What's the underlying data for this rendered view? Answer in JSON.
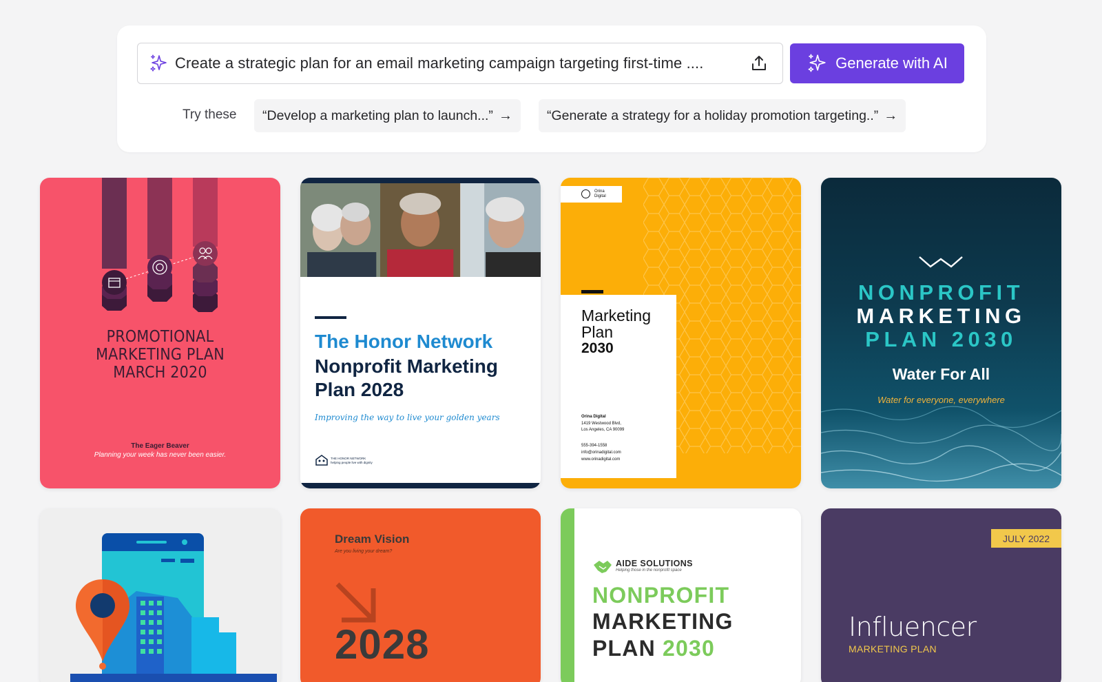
{
  "prompt": {
    "text": "Create a strategic plan for an email marketing campaign targeting first-time ....",
    "generate_label": "Generate with AI",
    "try_label": "Try these",
    "suggestions": [
      "“Develop a marketing plan to launch...”",
      "“Generate a strategy for a holiday promotion targeting..”"
    ],
    "arrow": "→"
  },
  "templates": {
    "promo": {
      "title_line1": "PROMOTIONAL",
      "title_line2": "MARKETING PLAN",
      "title_line3": "MARCH 2020",
      "brand": "The Eager Beaver",
      "tagline": "Planning your week has never been easier."
    },
    "honor": {
      "title": "The Honor Network",
      "subtitle": "Nonprofit Marketing Plan 2028",
      "tagline": "Improving the way to live your golden years",
      "footer_name": "THE HONOR NETWORK",
      "footer_tag": "helping people live with dignity"
    },
    "orina": {
      "logo_line1": "Orina",
      "logo_line2": "Digital",
      "title_line1": "Marketing",
      "title_line2": "Plan",
      "year": "2030",
      "addr_name": "Orina Digital",
      "addr_line1": "1419 Westwood Blvd,",
      "addr_line2": "Los Angeles, CA 90099",
      "phone": "555-394-1558",
      "email": "info@orinadigital.com",
      "web": "www.orinadigital.com"
    },
    "water": {
      "line1": "NONPROFIT",
      "line2": "MARKETING",
      "line3": "PLAN 2030",
      "title": "Water For All",
      "tagline": "Water for everyone, everywhere"
    },
    "dream": {
      "title": "Dream Vision",
      "question": "Are you living your dream?",
      "year": "2028"
    },
    "aide": {
      "name": "AIDE SOLUTIONS",
      "tagline": "Helping those in the nonprofit space",
      "line1": "NONPROFIT",
      "line2": "MARKETING",
      "line3_a": "PLAN",
      "line3_b": "2030"
    },
    "influencer": {
      "date": "JULY 2022",
      "title": "Influencer",
      "subtitle": "MARKETING PLAN"
    }
  },
  "colors": {
    "accent": "#6b3fe0",
    "promo_bg": "#f7536a",
    "honor_navy": "#102542",
    "honor_blue": "#1e8ad0",
    "orina_yellow": "#fcae08",
    "water_teal": "#2bc6c6",
    "dream_orange": "#f15a2b",
    "aide_green": "#7ccb5b",
    "influencer_purple": "#4a3b63",
    "influencer_gold": "#f2c84b"
  },
  "icons": [
    "sparkle-icon",
    "upload-icon",
    "arrow-right-icon",
    "calendar-icon",
    "target-icon",
    "people-icon",
    "chevron-down-icon",
    "location-pin-icon",
    "handshake-icon",
    "hexagon-logo-icon",
    "house-people-icon"
  ]
}
